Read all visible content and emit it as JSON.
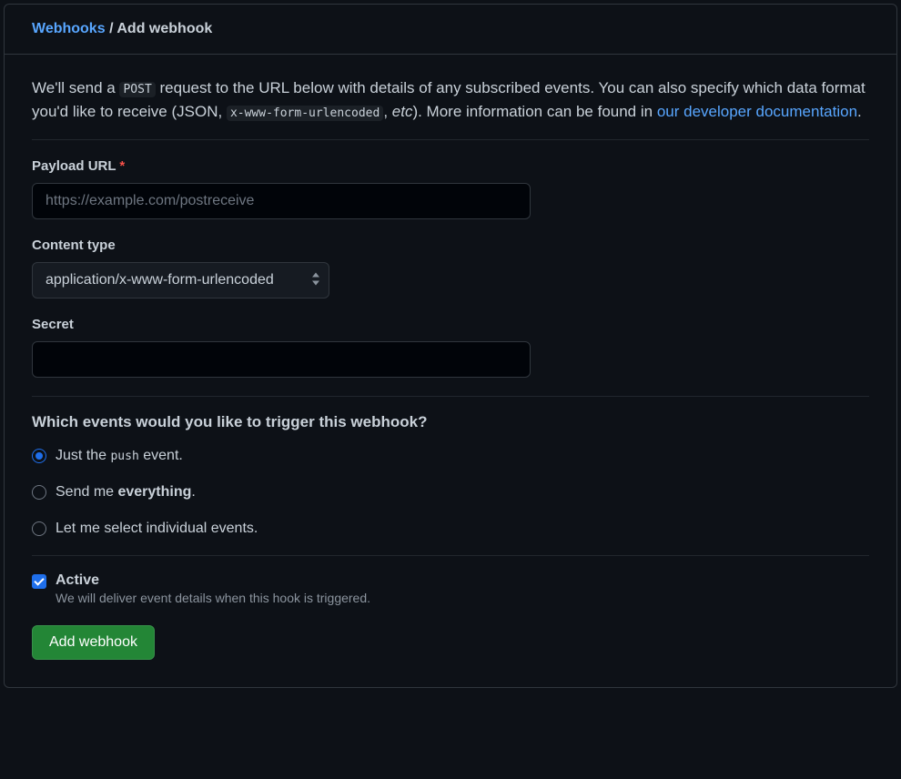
{
  "breadcrumb": {
    "link": "Webhooks",
    "separator": "/",
    "current": "Add webhook"
  },
  "intro": {
    "text_1": "We'll send a ",
    "code_1": "POST",
    "text_2": " request to the URL below with details of any subscribed events. You can also specify which data format you'd like to receive (JSON, ",
    "code_2": "x-www-form-urlencoded",
    "text_3": ", ",
    "italic": "etc",
    "text_4": "). More information can be found in ",
    "link": "our developer documentation",
    "period": "."
  },
  "payload_url": {
    "label": "Payload URL",
    "placeholder": "https://example.com/postreceive",
    "value": ""
  },
  "content_type": {
    "label": "Content type",
    "selected": "application/x-www-form-urlencoded"
  },
  "secret": {
    "label": "Secret",
    "value": ""
  },
  "events": {
    "heading": "Which events would you like to trigger this webhook?",
    "option_push_pre": "Just the ",
    "option_push_code": "push",
    "option_push_post": " event.",
    "option_everything_pre": "Send me ",
    "option_everything_bold": "everything",
    "option_everything_post": ".",
    "option_individual": "Let me select individual events."
  },
  "active": {
    "label": "Active",
    "description": "We will deliver event details when this hook is triggered."
  },
  "submit": {
    "label": "Add webhook"
  }
}
